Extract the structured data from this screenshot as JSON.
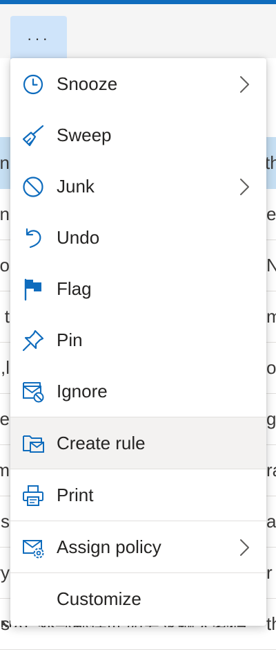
{
  "toolbar": {
    "more_label": "···"
  },
  "background": {
    "rows": [
      {
        "left": "n",
        "right": "th"
      },
      {
        "left": "n",
        "right": "e"
      },
      {
        "left": "o",
        "right": "N"
      },
      {
        "left": "t",
        "right": "m"
      },
      {
        "left": "l,",
        "right": "o"
      },
      {
        "left": "e",
        "right": "gh"
      },
      {
        "left": "m",
        "right": "ra"
      },
      {
        "left": "s",
        "right": "ail"
      },
      {
        "left": "ry",
        "right": "r"
      },
      {
        "left": "os",
        "right": "th"
      }
    ],
    "bottom_text": "NAL 外部邮件!!! 如要求输入密码"
  },
  "menu": {
    "items": [
      {
        "label": "Snooze",
        "icon": "clock-icon",
        "submenu": true
      },
      {
        "label": "Sweep",
        "icon": "broom-icon",
        "submenu": false
      },
      {
        "label": "Junk",
        "icon": "prohibited-icon",
        "submenu": true
      },
      {
        "label": "Undo",
        "icon": "undo-icon",
        "submenu": false
      },
      {
        "label": "Flag",
        "icon": "flag-icon",
        "submenu": false
      },
      {
        "label": "Pin",
        "icon": "pin-icon",
        "submenu": false
      },
      {
        "label": "Ignore",
        "icon": "ignore-mail-icon",
        "submenu": false
      },
      {
        "label": "Create rule",
        "icon": "folder-mail-icon",
        "submenu": false
      },
      {
        "label": "Print",
        "icon": "printer-icon",
        "submenu": false
      },
      {
        "label": "Assign policy",
        "icon": "mail-settings-icon",
        "submenu": true
      },
      {
        "label": "Customize",
        "icon": "",
        "submenu": false
      }
    ]
  },
  "colors": {
    "accent": "#0f6cbd",
    "icon": "#0f6cbd",
    "hover": "#f3f2f1"
  }
}
